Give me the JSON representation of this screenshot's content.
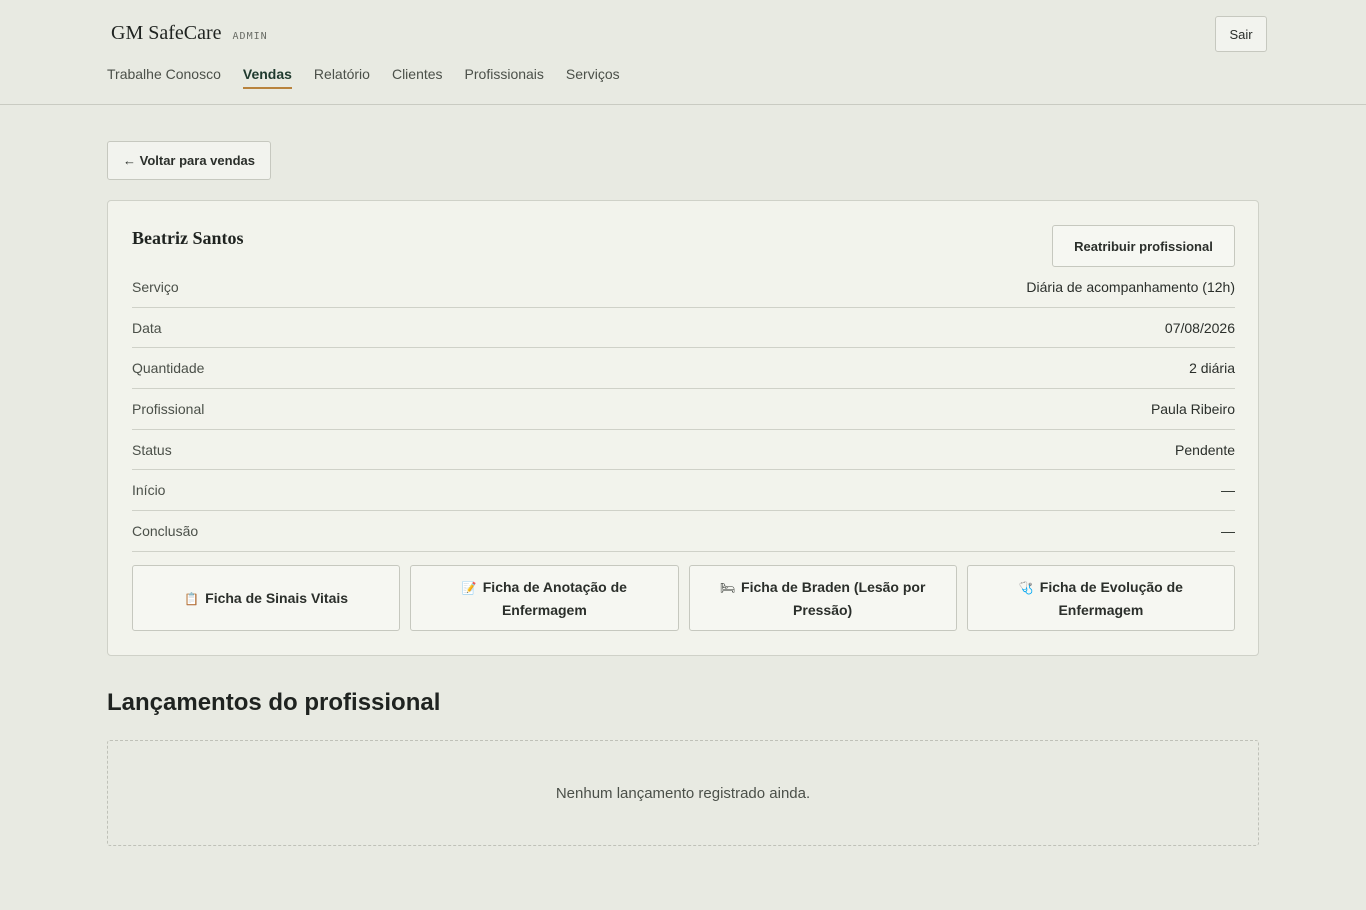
{
  "header": {
    "brand": "GM SafeCare",
    "brand_tag": "ADMIN",
    "logout_label": "Sair",
    "nav": [
      {
        "label": "Trabalhe Conosco",
        "active": false
      },
      {
        "label": "Vendas",
        "active": true
      },
      {
        "label": "Relatório",
        "active": false
      },
      {
        "label": "Clientes",
        "active": false
      },
      {
        "label": "Profissionais",
        "active": false
      },
      {
        "label": "Serviços",
        "active": false
      }
    ]
  },
  "back_label": "← Voltar para vendas",
  "sale": {
    "client_name": "Beatriz Santos",
    "reassign_label": "Reatribuir profissional",
    "details": [
      {
        "label": "Serviço",
        "value": "Diária de acompanhamento (12h)"
      },
      {
        "label": "Data",
        "value": "07/08/2026"
      },
      {
        "label": "Quantidade",
        "value": "2 diária"
      },
      {
        "label": "Profissional",
        "value": "Paula Ribeiro"
      },
      {
        "label": "Status",
        "value": "Pendente"
      },
      {
        "label": "Início",
        "value": "—"
      },
      {
        "label": "Conclusão",
        "value": "—"
      }
    ],
    "sheets": [
      {
        "icon": "📋",
        "icon_name": "clipboard-icon",
        "label": "Ficha de Sinais Vitais"
      },
      {
        "icon": "📝",
        "icon_name": "memo-icon",
        "label": "Ficha de Anotação de Enfermagem"
      },
      {
        "icon": "🛏",
        "icon_name": "bed-icon",
        "label": "Ficha de Braden (Lesão por Pressão)"
      },
      {
        "icon": "🩺",
        "icon_name": "stethoscope-icon",
        "label": "Ficha de Evolução de Enfermagem"
      }
    ]
  },
  "entries": {
    "title": "Lançamentos do profissional",
    "empty_message": "Nenhum lançamento registrado ainda."
  },
  "colors": {
    "background": "#e8eae2",
    "accent_underline": "#b8833d",
    "active_nav": "#1f3a2e"
  }
}
